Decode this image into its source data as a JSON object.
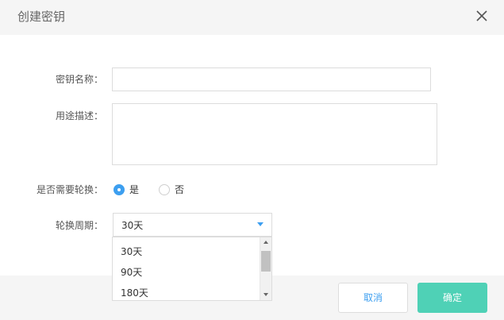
{
  "dialog": {
    "title": "创建密钥",
    "close_icon": "close-icon"
  },
  "form": {
    "name": {
      "label": "密钥名称：",
      "value": "",
      "placeholder": ""
    },
    "description": {
      "label": "用途描述：",
      "value": "",
      "placeholder": ""
    },
    "rotation": {
      "label": "是否需要轮换：",
      "options": [
        {
          "label": "是",
          "checked": true
        },
        {
          "label": "否",
          "checked": false
        }
      ]
    },
    "period": {
      "label": "轮换周期：",
      "selected": "30天",
      "dropdown_options": [
        "30天",
        "90天",
        "180天"
      ]
    }
  },
  "footer": {
    "cancel_label": "取消",
    "ok_label": "确定"
  },
  "colors": {
    "accent": "#3d9ff0",
    "confirm": "#4fd1b6",
    "header_bg": "#f5f5f5"
  }
}
